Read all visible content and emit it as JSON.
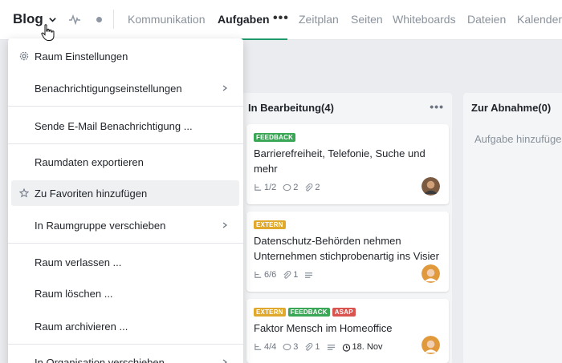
{
  "header": {
    "room_title": "Blog",
    "tabs": [
      {
        "label": "Kommunikation"
      },
      {
        "label": "Aufgaben"
      },
      {
        "label": "Zeitplan"
      },
      {
        "label": "Seiten"
      },
      {
        "label": "Whiteboards"
      },
      {
        "label": "Dateien"
      },
      {
        "label": "Kalender"
      }
    ],
    "more_label": "•••"
  },
  "menu": {
    "items": [
      {
        "label": "Raum Einstellungen",
        "icon": "gear-icon"
      },
      {
        "label": "Benachrichtigungseinstellungen",
        "submenu": true
      },
      {
        "label": "Sende E-Mail Benachrichtigung ..."
      },
      {
        "label": "Raumdaten exportieren"
      },
      {
        "label": "Zu Favoriten hinzufügen",
        "icon": "star-icon",
        "hovered": true
      },
      {
        "label": "In Raumgruppe verschieben",
        "submenu": true
      },
      {
        "label": "Raum verlassen ..."
      },
      {
        "label": "Raum löschen ..."
      },
      {
        "label": "Raum archivieren ..."
      },
      {
        "label": "In Organisation verschieben",
        "submenu": true
      }
    ]
  },
  "board": {
    "columns": [
      {
        "title": "In Bearbeitung(4)",
        "more_label": "•••"
      },
      {
        "title": "Zur Abnahme(0)",
        "add_placeholder": "Aufgabe hinzufügen"
      }
    ],
    "cards": [
      {
        "tags": [
          {
            "label": "FEEDBACK",
            "color": "#3aa757"
          }
        ],
        "title": "Barrierefreiheit, Telefonie, Suche und mehr",
        "subtasks": "1/2",
        "comments": "2",
        "attachments": "2"
      },
      {
        "tags": [
          {
            "label": "EXTERN",
            "color": "#e0a92e"
          }
        ],
        "title": "Datenschutz-Behörden nehmen Unternehmen stichprobenartig ins Visier",
        "subtasks": "6/6",
        "attachments": "1"
      },
      {
        "tags": [
          {
            "label": "EXTERN",
            "color": "#e0a92e"
          },
          {
            "label": "FEEDBACK",
            "color": "#3aa757"
          },
          {
            "label": "ASAP",
            "color": "#d9534f"
          }
        ],
        "title": "Faktor Mensch im Homeoffice",
        "subtasks": "4/4",
        "comments": "3",
        "attachments": "1",
        "due": "18. Nov"
      }
    ]
  },
  "colors": {
    "accent": "#1f9a6a",
    "feedback": "#3aa757",
    "extern": "#e0a92e",
    "asap": "#d9534f"
  }
}
